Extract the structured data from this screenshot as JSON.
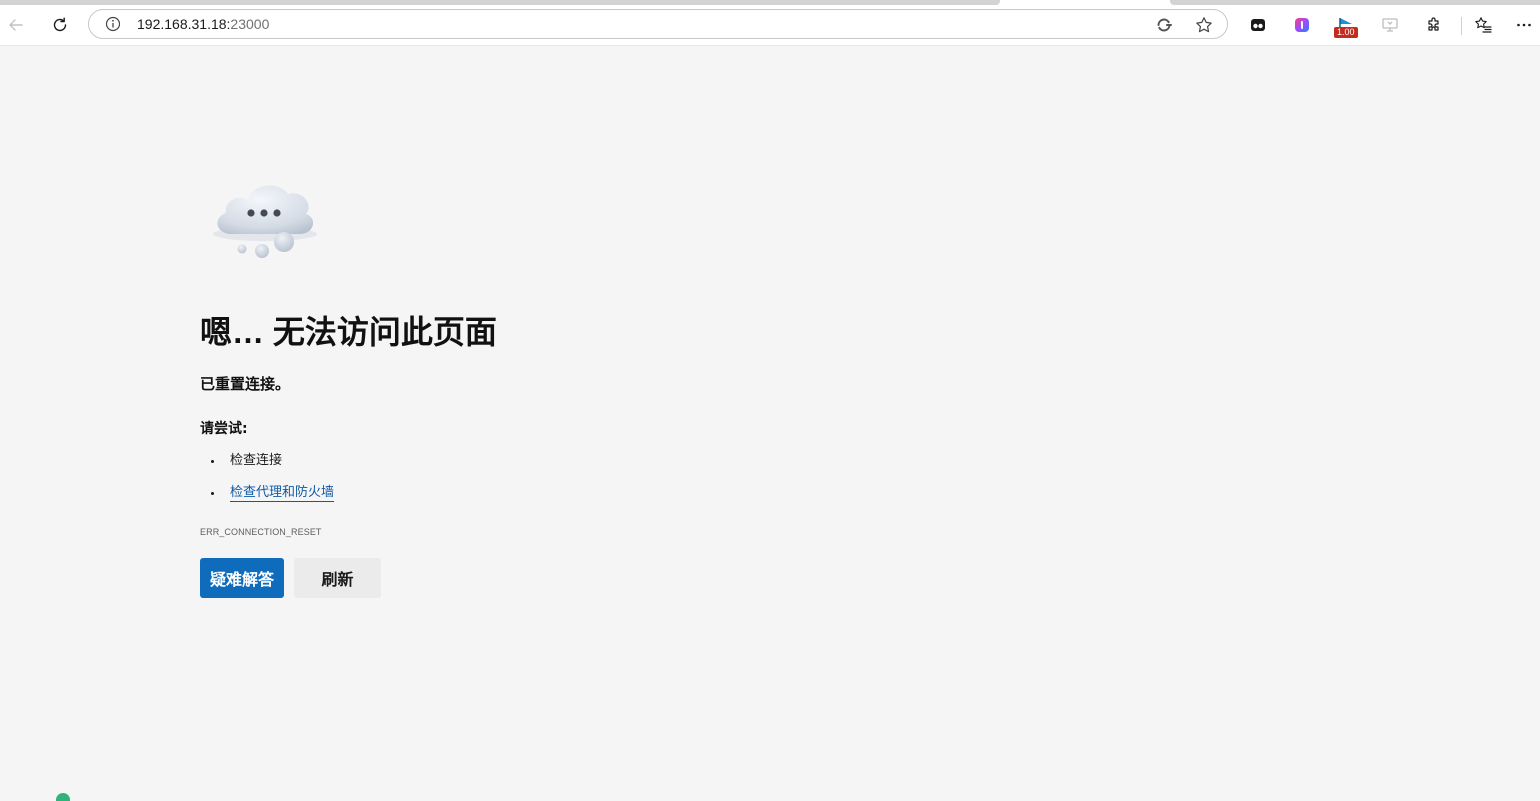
{
  "browser": {
    "address": {
      "host": "192.168.31.18:",
      "port": "23000"
    },
    "extension_badge": "1.00",
    "icons": {
      "back": "back-arrow-icon",
      "refresh": "refresh-icon",
      "info": "info-icon",
      "read_aloud": "edge-refresh-icon",
      "favorite": "star-icon",
      "ext1": "extension-dark-icon",
      "ext2": "extension-gradient-icon",
      "ext3": "extension-blue-flag-icon",
      "ext4": "extension-gray-icon",
      "extensions": "puzzle-icon",
      "favorites": "favorites-list-icon",
      "more": "more-icon"
    }
  },
  "error_page": {
    "title": "嗯… 无法访问此页面",
    "subtitle": "已重置连接。",
    "try_label": "请尝试:",
    "suggestions": [
      {
        "text": "检查连接",
        "link": false
      },
      {
        "text": "检查代理和防火墙",
        "link": true
      }
    ],
    "error_code": "ERR_CONNECTION_RESET",
    "buttons": {
      "troubleshoot": "疑难解答",
      "refresh": "刷新"
    }
  },
  "colors": {
    "page_background": "#f5f5f5",
    "primary_button": "#0f6cbd",
    "link": "#0f5aa6"
  }
}
